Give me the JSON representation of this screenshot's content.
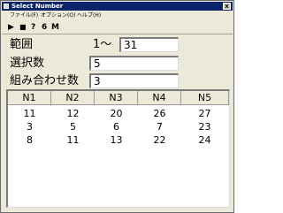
{
  "window": {
    "title": "Select Number",
    "close_label": "x"
  },
  "menu": [
    "ファイル(F)",
    "オプション(O)",
    "ヘルプ(H)"
  ],
  "toolbar": {
    "play": "▶",
    "save": "■",
    "help": "?",
    "six": "6",
    "m": "M"
  },
  "form": {
    "range_label": "範囲",
    "range_prefix": "1〜",
    "range_value": "31",
    "count_label": "選択数",
    "count_value": "5",
    "combo_label": "組み合わせ数",
    "combo_value": "3"
  },
  "table": {
    "headers": [
      "N1",
      "N2",
      "N3",
      "N4",
      "N5"
    ],
    "rows": [
      [
        "11",
        "12",
        "20",
        "26",
        "27"
      ],
      [
        "3",
        "5",
        "6",
        "7",
        "23"
      ],
      [
        "8",
        "11",
        "13",
        "22",
        "24"
      ]
    ]
  }
}
